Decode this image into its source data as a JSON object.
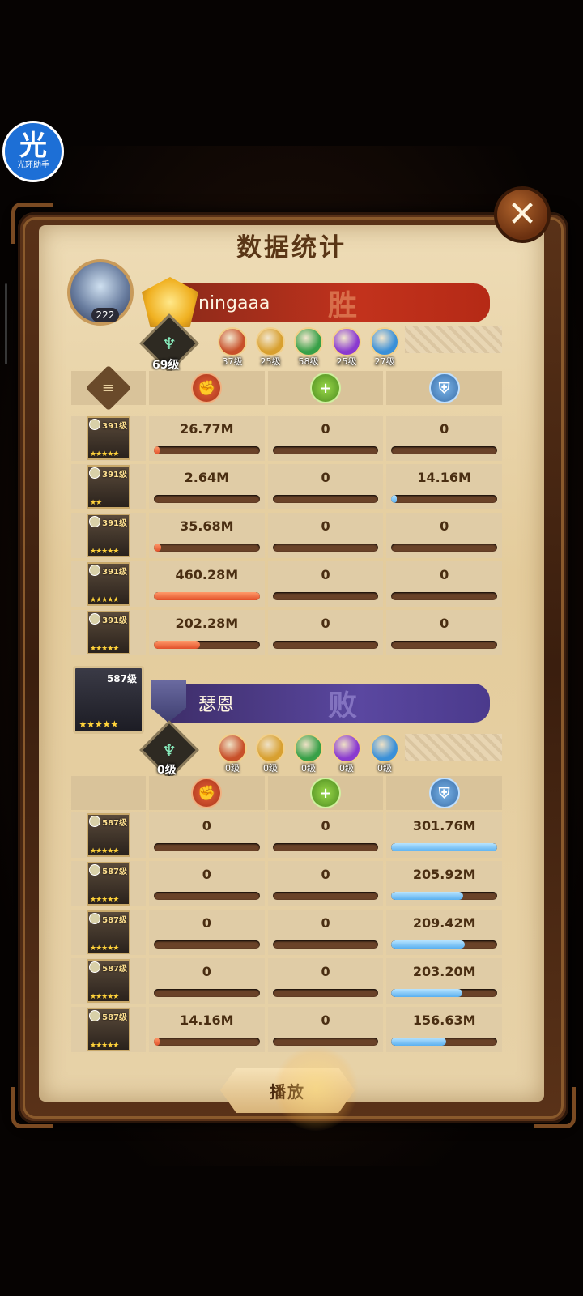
{
  "assistant": {
    "glyph": "光",
    "label": "光环助手"
  },
  "dialog": {
    "title": "数据统计",
    "close_label": "✕"
  },
  "columns": {
    "doc_icon": "document-icon",
    "damage_icon": "damage-fist-icon",
    "heal_icon": "heal-icon",
    "shield_icon": "shield-icon"
  },
  "team1": {
    "name": "ningaaa",
    "result": "胜",
    "player_level": "222",
    "tree_level": "69级",
    "factions": [
      {
        "level": "37级",
        "color": "#c8502a"
      },
      {
        "level": "25级",
        "color": "#d8a030"
      },
      {
        "level": "58级",
        "color": "#38a048"
      },
      {
        "level": "25级",
        "color": "#8a3ad0"
      },
      {
        "level": "27级",
        "color": "#3a90d8"
      }
    ],
    "heroes": [
      {
        "level": "391级",
        "stars": "★★★★★",
        "damage": "26.77M",
        "damage_frac": 0.03,
        "heal": "0",
        "heal_frac": 0,
        "shield": "0",
        "shield_frac": 0
      },
      {
        "level": "391级",
        "stars": "★★",
        "damage": "2.64M",
        "damage_frac": 0.0,
        "heal": "0",
        "heal_frac": 0,
        "shield": "14.16M",
        "shield_frac": 0.05
      },
      {
        "level": "391级",
        "stars": "★★★★★",
        "damage": "35.68M",
        "damage_frac": 0.07,
        "heal": "0",
        "heal_frac": 0,
        "shield": "0",
        "shield_frac": 0
      },
      {
        "level": "391级",
        "stars": "★★★★★",
        "damage": "460.28M",
        "damage_frac": 1.0,
        "heal": "0",
        "heal_frac": 0,
        "shield": "0",
        "shield_frac": 0
      },
      {
        "level": "391级",
        "stars": "★★★★★",
        "damage": "202.28M",
        "damage_frac": 0.44,
        "heal": "0",
        "heal_frac": 0,
        "shield": "0",
        "shield_frac": 0
      }
    ]
  },
  "team2": {
    "name": "瑟恩",
    "result": "败",
    "boss_level": "587级",
    "boss_stars": "★★★★★",
    "tree_level": "0级",
    "factions": [
      {
        "level": "0级",
        "color": "#c8502a"
      },
      {
        "level": "0级",
        "color": "#d8a030"
      },
      {
        "level": "0级",
        "color": "#38a048"
      },
      {
        "level": "0级",
        "color": "#8a3ad0"
      },
      {
        "level": "0级",
        "color": "#3a90d8"
      }
    ],
    "heroes": [
      {
        "level": "587级",
        "stars": "★★★★★",
        "damage": "0",
        "damage_frac": 0,
        "heal": "0",
        "heal_frac": 0,
        "shield": "301.76M",
        "shield_frac": 1.0
      },
      {
        "level": "587级",
        "stars": "★★★★★",
        "damage": "0",
        "damage_frac": 0,
        "heal": "0",
        "heal_frac": 0,
        "shield": "205.92M",
        "shield_frac": 0.68
      },
      {
        "level": "587级",
        "stars": "★★★★★",
        "damage": "0",
        "damage_frac": 0,
        "heal": "0",
        "heal_frac": 0,
        "shield": "209.42M",
        "shield_frac": 0.69
      },
      {
        "level": "587级",
        "stars": "★★★★★",
        "damage": "0",
        "damage_frac": 0,
        "heal": "0",
        "heal_frac": 0,
        "shield": "203.20M",
        "shield_frac": 0.67
      },
      {
        "level": "587级",
        "stars": "★★★★★",
        "damage": "14.16M",
        "damage_frac": 0.05,
        "heal": "0",
        "heal_frac": 0,
        "shield": "156.63M",
        "shield_frac": 0.52
      }
    ]
  },
  "play_button": {
    "label": "播放"
  }
}
